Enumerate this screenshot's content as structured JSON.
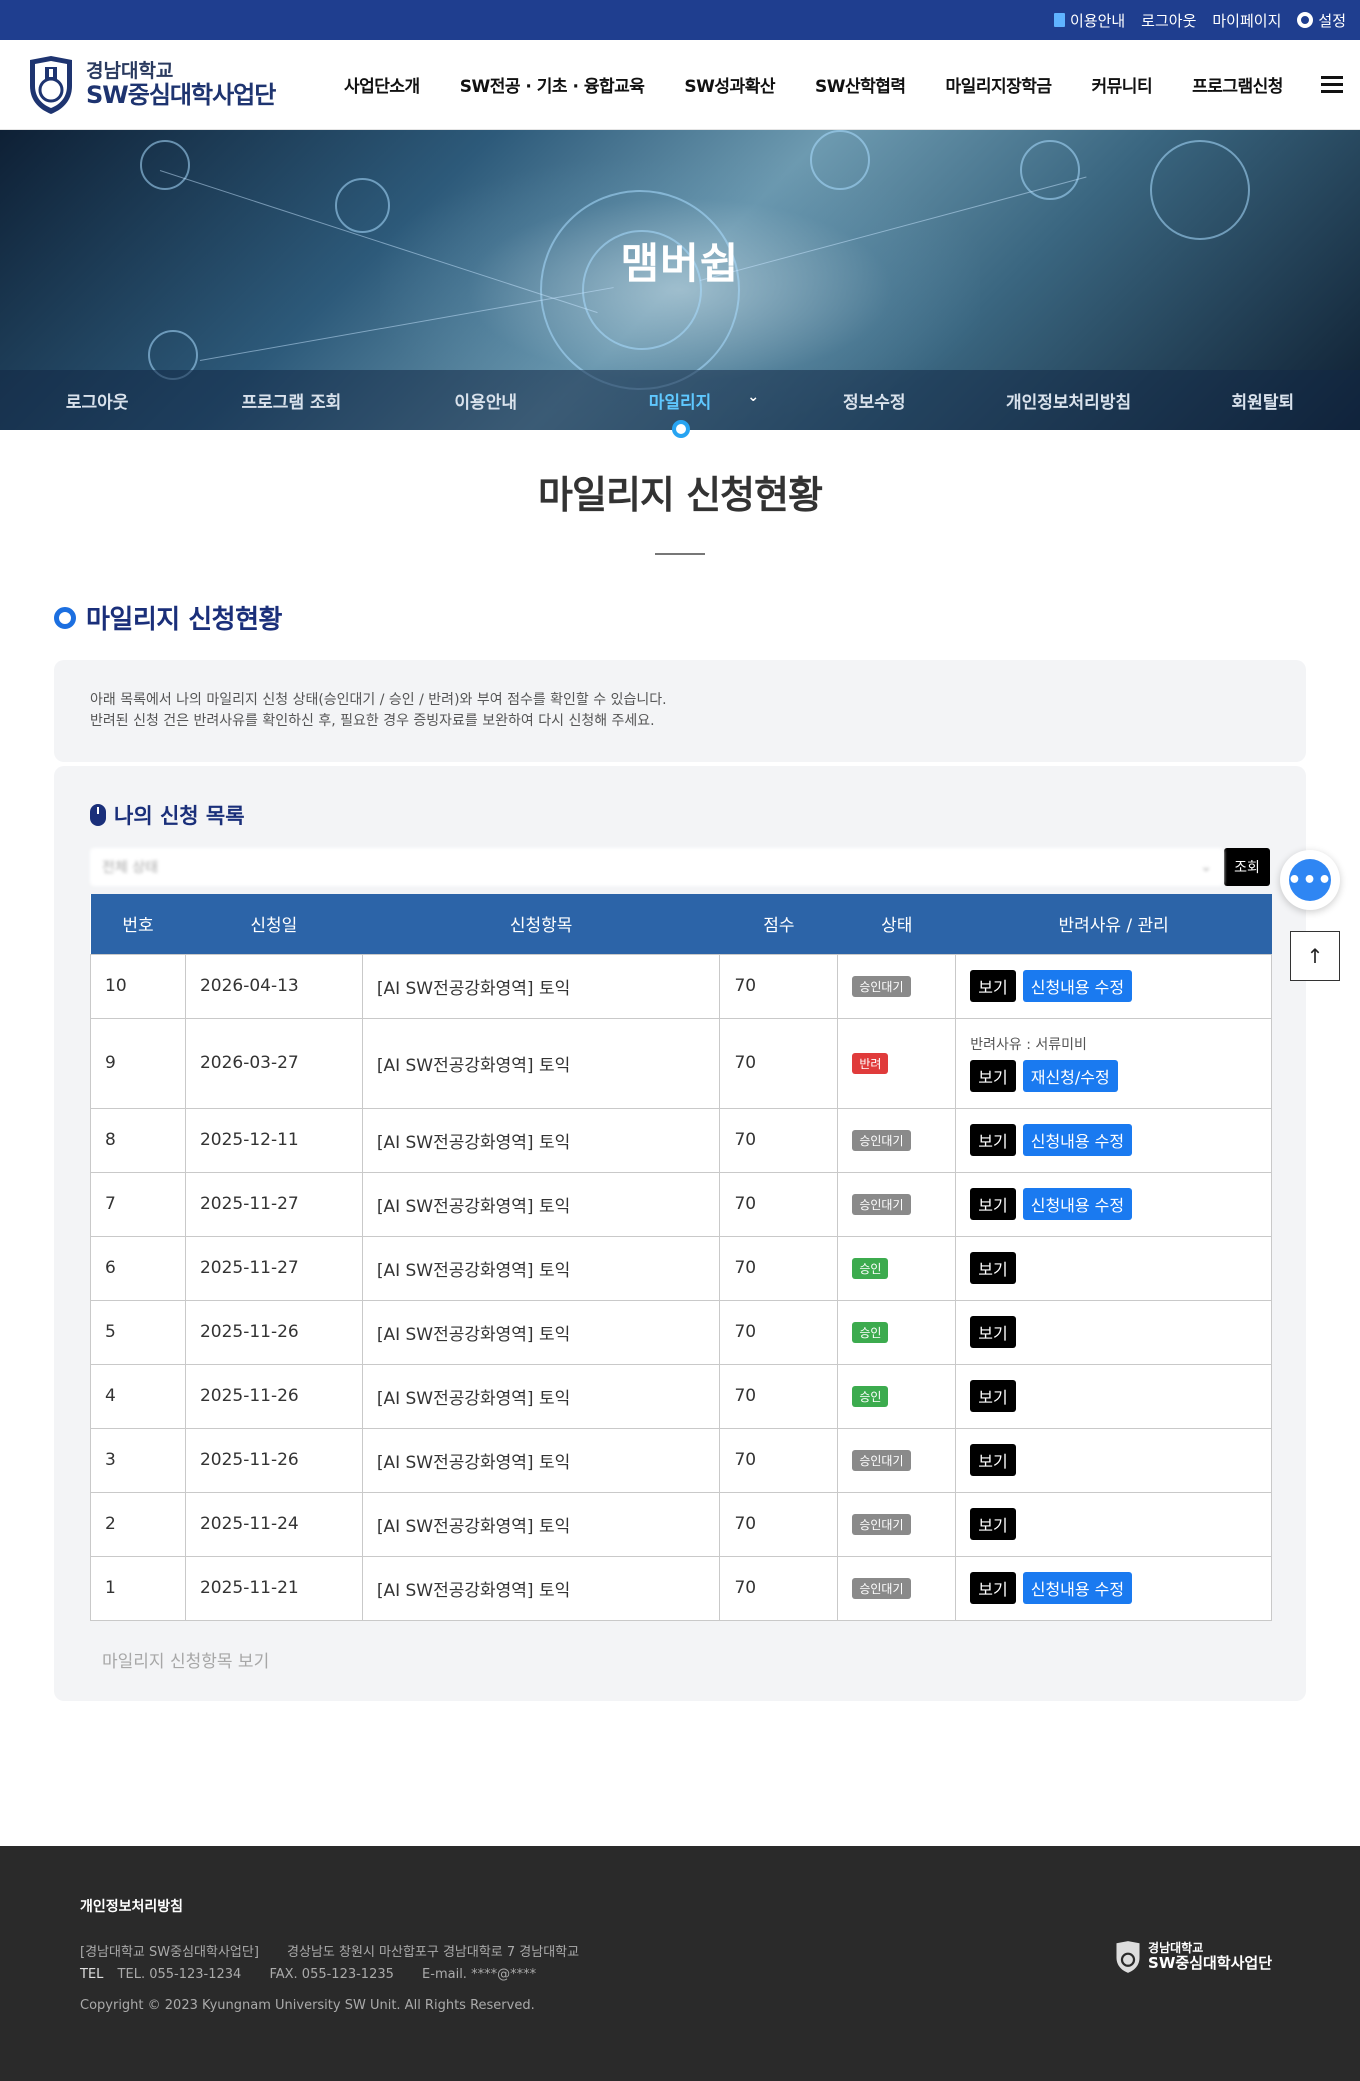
{
  "topbar": {
    "guide": "이용안내",
    "logout": "로그아웃",
    "mypage": "마이페이지",
    "settings": "설정"
  },
  "logo": {
    "small": "경남대학교",
    "big": "SW중심대학사업단"
  },
  "gnb": [
    "사업단소개",
    "SW전공 · 기초 · 융합교육",
    "SW성과확산",
    "SW산학협력",
    "마일리지장학금",
    "커뮤니티",
    "프로그램신청"
  ],
  "visual": {
    "title": "맴버쉽"
  },
  "subnav": [
    "로그아웃",
    "프로그램 조회",
    "이용안내",
    "마일리지",
    "정보수정",
    "개인정보처리방침",
    "회원탈퇴"
  ],
  "subnav_active": 3,
  "page": {
    "title": "마일리지 신청현황",
    "section_title": "마일리지 신청현황",
    "info_line1": "아래 목록에서 나의 마일리지 신청 상태(승인대기 / 승인 / 반려)와 부여 점수를 확인할 수 있습니다.",
    "info_line2": "반려된 신청 건은 반려사유를 확인하신 후, 필요한 경우 증빙자료를 보완하여 다시 신청해 주세요.",
    "list_title": "나의 신청 목록",
    "filter_placeholder": "전체 상태",
    "filter_button": "조회",
    "more_link": "마일리지 신청항목 보기"
  },
  "table": {
    "headers": [
      "번호",
      "신청일",
      "신청항목",
      "점수",
      "상태",
      "반려사유 / 관리"
    ],
    "rows": [
      {
        "no": "10",
        "date": "2026-04-13",
        "item": "[AI SW전공강화영역] 토익",
        "score": "70",
        "status": "승인대기",
        "status_type": "wait",
        "reason": "",
        "view": "보기",
        "edit": "신청내용 수정"
      },
      {
        "no": "9",
        "date": "2026-03-27",
        "item": "[AI SW전공강화영역] 토익",
        "score": "70",
        "status": "반려",
        "status_type": "reject",
        "reason": "반려사유 : 서류미비",
        "view": "보기",
        "edit": "재신청/수정"
      },
      {
        "no": "8",
        "date": "2025-12-11",
        "item": "[AI SW전공강화영역] 토익",
        "score": "70",
        "status": "승인대기",
        "status_type": "wait",
        "reason": "",
        "view": "보기",
        "edit": "신청내용 수정"
      },
      {
        "no": "7",
        "date": "2025-11-27",
        "item": "[AI SW전공강화영역] 토익",
        "score": "70",
        "status": "승인대기",
        "status_type": "wait",
        "reason": "",
        "view": "보기",
        "edit": "신청내용 수정"
      },
      {
        "no": "6",
        "date": "2025-11-27",
        "item": "[AI SW전공강화영역] 토익",
        "score": "70",
        "status": "승인",
        "status_type": "ok",
        "reason": "",
        "view": "보기",
        "edit": ""
      },
      {
        "no": "5",
        "date": "2025-11-26",
        "item": "[AI SW전공강화영역] 토익",
        "score": "70",
        "status": "승인",
        "status_type": "ok",
        "reason": "",
        "view": "보기",
        "edit": ""
      },
      {
        "no": "4",
        "date": "2025-11-26",
        "item": "[AI SW전공강화영역] 토익",
        "score": "70",
        "status": "승인",
        "status_type": "ok",
        "reason": "",
        "view": "보기",
        "edit": ""
      },
      {
        "no": "3",
        "date": "2025-11-26",
        "item": "[AI SW전공강화영역] 토익",
        "score": "70",
        "status": "승인대기",
        "status_type": "wait",
        "reason": "",
        "view": "보기",
        "edit": ""
      },
      {
        "no": "2",
        "date": "2025-11-24",
        "item": "[AI SW전공강화영역] 토익",
        "score": "70",
        "status": "승인대기",
        "status_type": "wait",
        "reason": "",
        "view": "보기",
        "edit": ""
      },
      {
        "no": "1",
        "date": "2025-11-21",
        "item": "[AI SW전공강화영역] 토익",
        "score": "70",
        "status": "승인대기",
        "status_type": "wait",
        "reason": "",
        "view": "보기",
        "edit": "신청내용 수정"
      }
    ]
  },
  "floating": {
    "chat_icon": "chat-bubble-icon",
    "top_icon": "arrow-up-icon",
    "top_glyph": "↑",
    "chat_glyph": "•••"
  },
  "footer": {
    "privacy": "개인정보처리방침",
    "org": "[경남대학교 SW중심대학사업단]",
    "address": "경상남도 창원시 마산합포구 경남대학로 7 경남대학교",
    "tel_label": "TEL",
    "tel": "TEL. 055-123-1234",
    "fax": "FAX. 055-123-1235",
    "email": "E-mail. ****@****",
    "copyright": "Copyright © 2023 Kyungnam University SW Unit. All Rights Reserved.",
    "logo_small": "경남대학교",
    "logo_big": "SW중심대학사업단"
  },
  "colors": {
    "topbar": "#1f3e8f",
    "table_header": "#2c64a8",
    "accent": "#1a7af0",
    "approved": "#3cab4e",
    "rejected": "#e03b3b",
    "pending": "#8a8a8a"
  }
}
